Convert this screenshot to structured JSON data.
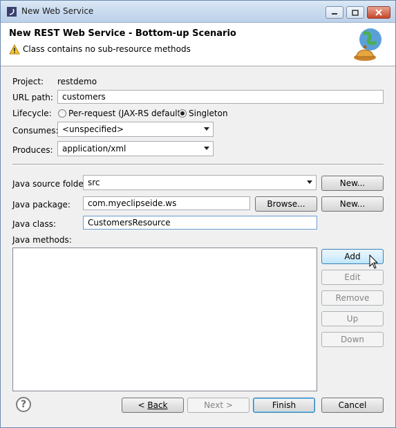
{
  "window": {
    "title": "New Web Service"
  },
  "header": {
    "title": "New REST Web Service - Bottom-up Scenario",
    "message": "Class contains no sub-resource methods"
  },
  "form": {
    "project_label": "Project:",
    "project_value": "restdemo",
    "url_label": "URL path:",
    "url_value": "customers",
    "lifecycle_label": "Lifecycle:",
    "lifecycle_options": [
      "Per-request (JAX-RS default)",
      "Singleton"
    ],
    "lifecycle_selected": "Singleton",
    "consumes_label": "Consumes:",
    "consumes_value": "<unspecified>",
    "produces_label": "Produces:",
    "produces_value": "application/xml",
    "source_folder_label": "Java source folder:",
    "source_folder_value": "src",
    "package_label": "Java package:",
    "package_value": "com.myeclipseide.ws",
    "class_label": "Java class:",
    "class_value": "CustomersResource",
    "methods_label": "Java methods:"
  },
  "buttons": {
    "new_folder": "New...",
    "browse": "Browse...",
    "new_package": "New...",
    "add": "Add",
    "edit": "Edit",
    "remove": "Remove",
    "up": "Up",
    "down": "Down",
    "back": "Back",
    "next": "Next >",
    "finish": "Finish",
    "cancel": "Cancel"
  },
  "icons": {
    "app": "eclipse-icon",
    "warning": "warning-icon",
    "banner": "web-service-globe-bell-icon",
    "help": "help-icon"
  },
  "colors": {
    "titlebar": "#c9dbef",
    "close_button": "#c9452a",
    "focus_border": "#6b9bd1"
  }
}
